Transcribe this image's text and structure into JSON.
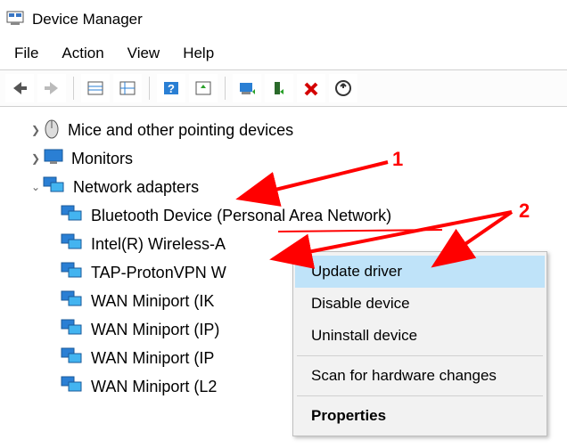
{
  "window": {
    "title": "Device Manager"
  },
  "menubar": {
    "items": [
      "File",
      "Action",
      "View",
      "Help"
    ]
  },
  "tree": {
    "mice": "Mice and other pointing devices",
    "monitors": "Monitors",
    "network": "Network adapters",
    "children": [
      "Bluetooth Device (Personal Area Network)",
      "Intel(R) Wireless-A",
      "TAP-ProtonVPN W",
      "WAN Miniport (IK",
      "WAN Miniport (IP)",
      "WAN Miniport (IP",
      "WAN Miniport (L2"
    ]
  },
  "context_menu": {
    "items": [
      "Update driver",
      "Disable device",
      "Uninstall device",
      "Scan for hardware changes",
      "Properties"
    ],
    "selected_index": 0,
    "bold_index": 4
  },
  "annotations": {
    "one": "1",
    "two": "2"
  }
}
